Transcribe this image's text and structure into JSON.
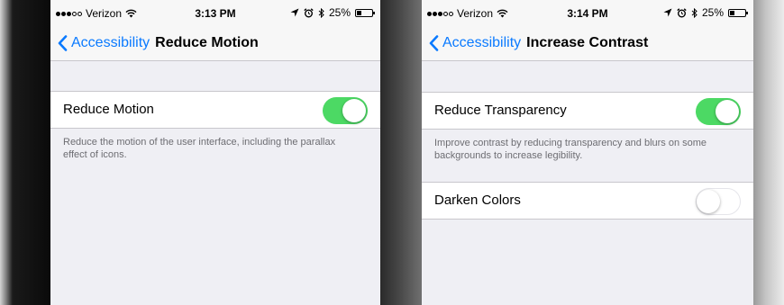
{
  "colors": {
    "accent": "#0a7aff",
    "toggle_on": "#4cd964",
    "background": "#efeff4"
  },
  "left": {
    "status": {
      "carrier": "Verizon",
      "signal_bars_filled": 3,
      "signal_bars_total": 5,
      "time": "3:13 PM",
      "battery": "25%"
    },
    "nav": {
      "back_label": "Accessibility",
      "title": "Reduce Motion"
    },
    "rows": [
      {
        "label": "Reduce Motion",
        "toggle_on": true
      }
    ],
    "footer": "Reduce the motion of the user interface, including the parallax effect of icons."
  },
  "right": {
    "status": {
      "carrier": "Verizon",
      "signal_bars_filled": 3,
      "signal_bars_total": 5,
      "time": "3:14 PM",
      "battery": "25%"
    },
    "nav": {
      "back_label": "Accessibility",
      "title": "Increase Contrast"
    },
    "rows": [
      {
        "label": "Reduce Transparency",
        "toggle_on": true
      },
      {
        "label": "Darken Colors",
        "toggle_on": false
      }
    ],
    "footer": "Improve contrast by reducing transparency and blurs on some backgrounds to increase legibility."
  },
  "icons": [
    "wifi-icon",
    "location-arrow-icon",
    "alarm-clock-icon",
    "bluetooth-icon",
    "battery-icon",
    "chevron-left-icon"
  ]
}
